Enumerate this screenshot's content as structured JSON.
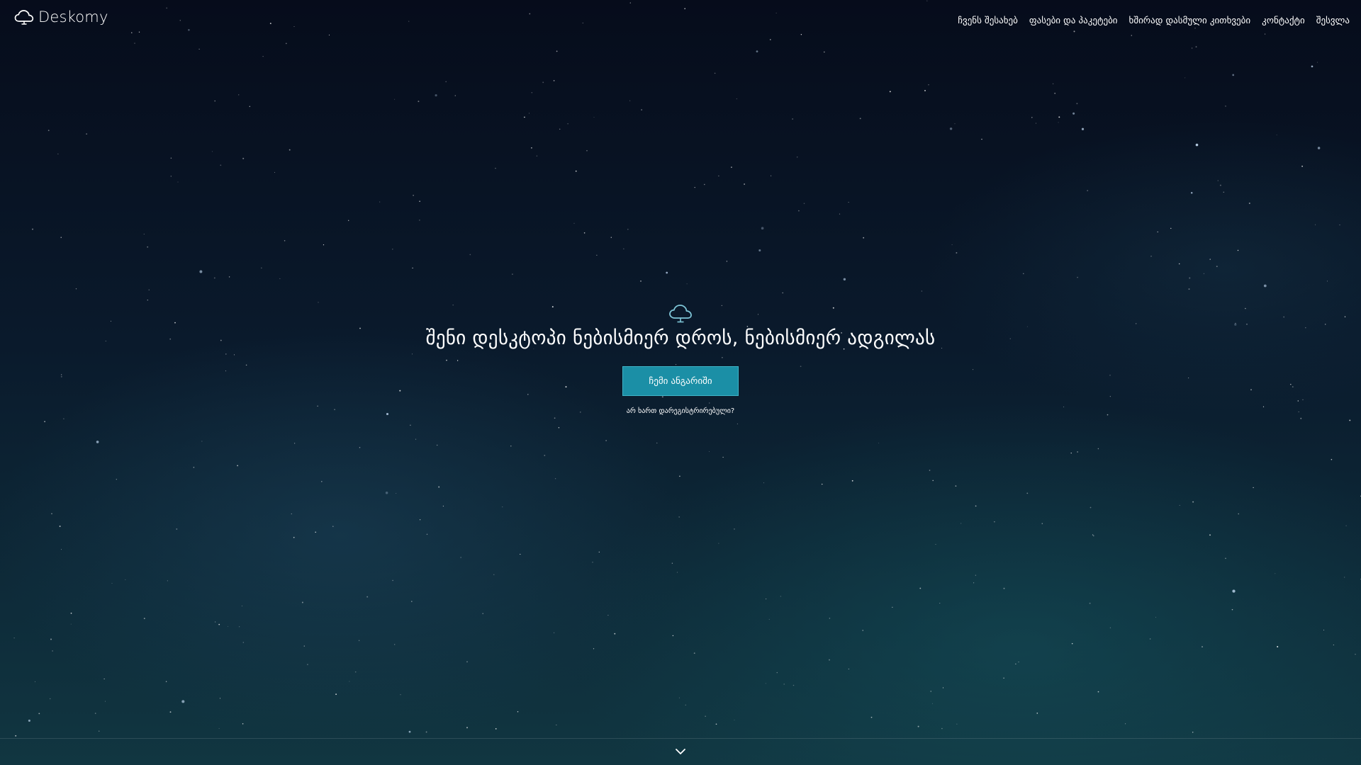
{
  "brand": {
    "name": "Deskomy",
    "logo_icon": "cloud-icon"
  },
  "nav": {
    "items": [
      {
        "label": "ჩვენს შესახებ"
      },
      {
        "label": "ფასები და პაკეტები"
      },
      {
        "label": "ხშირად დასმული კითხვები"
      },
      {
        "label": "კონტაქტი"
      },
      {
        "label": "შესვლა"
      }
    ]
  },
  "hero": {
    "icon": "cloud-desktop-icon",
    "headline": "შენი დესკტოპი ნებისმიერ დროს, ნებისმიერ ადგილას",
    "cta_label": "ჩემი ანგარიში",
    "register_link": "არ ხართ დარეგისტრირებული?"
  },
  "footer": {
    "scroll_icon": "chevron-down-icon"
  },
  "colors": {
    "background_top": "#060c1b",
    "background_bottom": "#113641",
    "accent": "#1b8fa6",
    "accent_border": "#3fb4c8",
    "icon_tint": "#7fc6d8"
  }
}
